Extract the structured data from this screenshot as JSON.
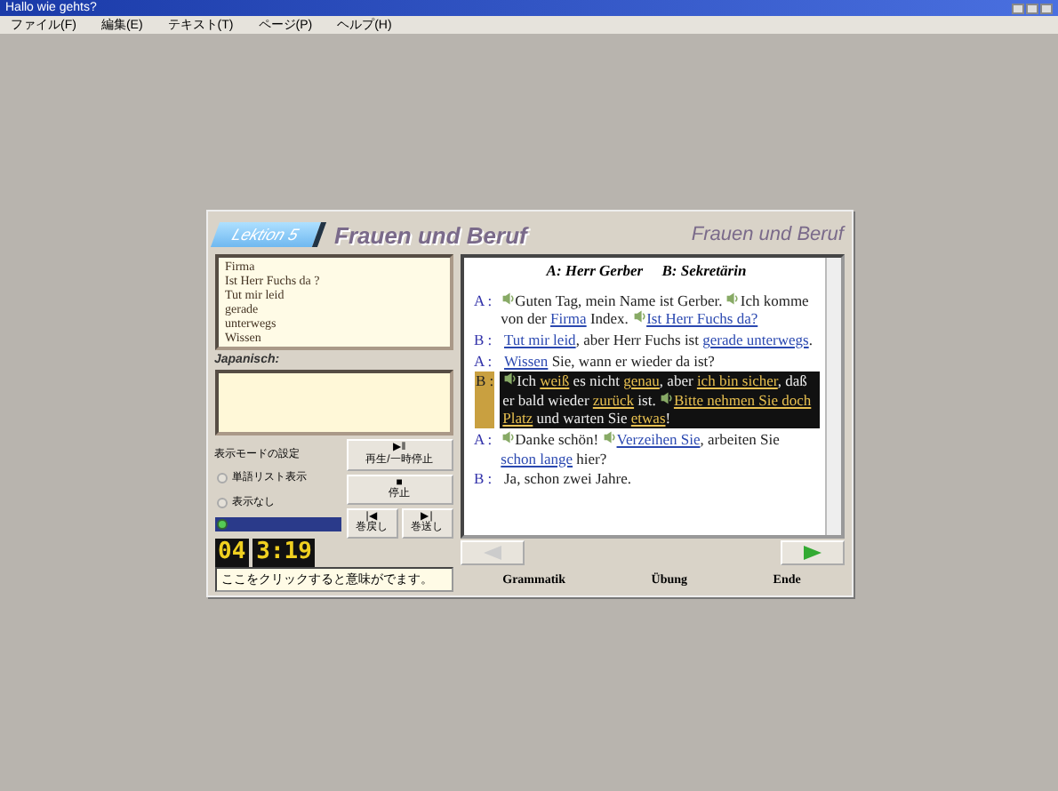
{
  "window": {
    "title": "Hallo wie gehts?"
  },
  "menu": [
    "ファイル(F)",
    "編集(E)",
    "テキスト(T)",
    "ページ(P)",
    "ヘルプ(H)"
  ],
  "header": {
    "lesson": "Lektion 5",
    "title": "Frauen und Beruf",
    "title_right": "Frauen und Beruf"
  },
  "word_list": [
    "Firma",
    "Ist Herr Fuchs da ?",
    "Tut mir leid",
    "gerade",
    "unterwegs",
    "Wissen"
  ],
  "japanese": {
    "label": "Japanisch:"
  },
  "display_mode": {
    "label": "表示モードの設定",
    "options": [
      {
        "label": "単語リスト表示",
        "selected": false
      },
      {
        "label": "表示なし",
        "selected": false
      },
      {
        "selected": true
      }
    ]
  },
  "controls": [
    {
      "symbol": "▶‖",
      "label": "再生/一時停止"
    },
    {
      "symbol": "■",
      "label": "停止"
    },
    {
      "symbol": "|◀",
      "label": "巻戻し"
    },
    {
      "symbol": "▶|",
      "label": "巻送し"
    }
  ],
  "dialogue": {
    "roles": "A: Herr Gerber     B: Sekretärin",
    "lines": [
      {
        "speaker": "A :",
        "selected": false,
        "segments": [
          {
            "kind": "audio"
          },
          {
            "kind": "plain",
            "text": "Guten Tag, mein Name ist Gerber. "
          },
          {
            "kind": "audio"
          },
          {
            "kind": "plain",
            "text": "Ich komme von der "
          },
          {
            "kind": "link",
            "text": "Firma"
          },
          {
            "kind": "plain",
            "text": " Index. "
          },
          {
            "kind": "audio"
          },
          {
            "kind": "link",
            "text": "Ist Herr Fuchs da?"
          }
        ]
      },
      {
        "speaker": "B :",
        "selected": false,
        "segments": [
          {
            "kind": "link",
            "text": "Tut mir leid"
          },
          {
            "kind": "plain",
            "text": ", aber Herr Fuchs ist "
          },
          {
            "kind": "link",
            "text": "gerade unterwegs"
          },
          {
            "kind": "plain",
            "text": "."
          }
        ]
      },
      {
        "speaker": "A :",
        "selected": false,
        "segments": [
          {
            "kind": "link",
            "text": "Wissen"
          },
          {
            "kind": "plain",
            "text": " Sie, wann er wieder da ist?"
          }
        ]
      },
      {
        "speaker": "B :",
        "selected": true,
        "segments": [
          {
            "kind": "audio"
          },
          {
            "kind": "plain",
            "text": "Ich "
          },
          {
            "kind": "link",
            "text": "weiß"
          },
          {
            "kind": "plain",
            "text": " es nicht "
          },
          {
            "kind": "link",
            "text": "genau"
          },
          {
            "kind": "plain",
            "text": ", aber "
          },
          {
            "kind": "link",
            "text": "ich bin sicher"
          },
          {
            "kind": "plain",
            "text": ", daß er bald wieder "
          },
          {
            "kind": "link",
            "text": "zurück"
          },
          {
            "kind": "plain",
            "text": " ist. "
          },
          {
            "kind": "audio"
          },
          {
            "kind": "link",
            "text": "Bitte nehmen Sie doch Platz"
          },
          {
            "kind": "plain",
            "text": " und warten Sie "
          },
          {
            "kind": "link",
            "text": "etwas"
          },
          {
            "kind": "plain",
            "text": "!"
          }
        ]
      },
      {
        "speaker": "A :",
        "selected": false,
        "segments": [
          {
            "kind": "audio"
          },
          {
            "kind": "plain",
            "text": "Danke schön! "
          },
          {
            "kind": "audio"
          },
          {
            "kind": "link",
            "text": "Verzeihen Sie"
          },
          {
            "kind": "plain",
            "text": ", arbeiten Sie "
          },
          {
            "kind": "link",
            "text": "schon lange"
          },
          {
            "kind": "plain",
            "text": " hier?"
          }
        ]
      },
      {
        "speaker": "B :",
        "selected": false,
        "segments": [
          {
            "kind": "plain",
            "text": "Ja, schon zwei Jahre."
          }
        ]
      }
    ]
  },
  "counter": {
    "page": "04",
    "time": "3:19"
  },
  "nav": [
    {
      "kind": "prev",
      "disabled": true
    },
    {
      "kind": "next",
      "disabled": false
    }
  ],
  "status": "ここをクリックすると意味がでます。",
  "footer_buttons": [
    "Grammatik",
    "Übung",
    "Ende"
  ]
}
